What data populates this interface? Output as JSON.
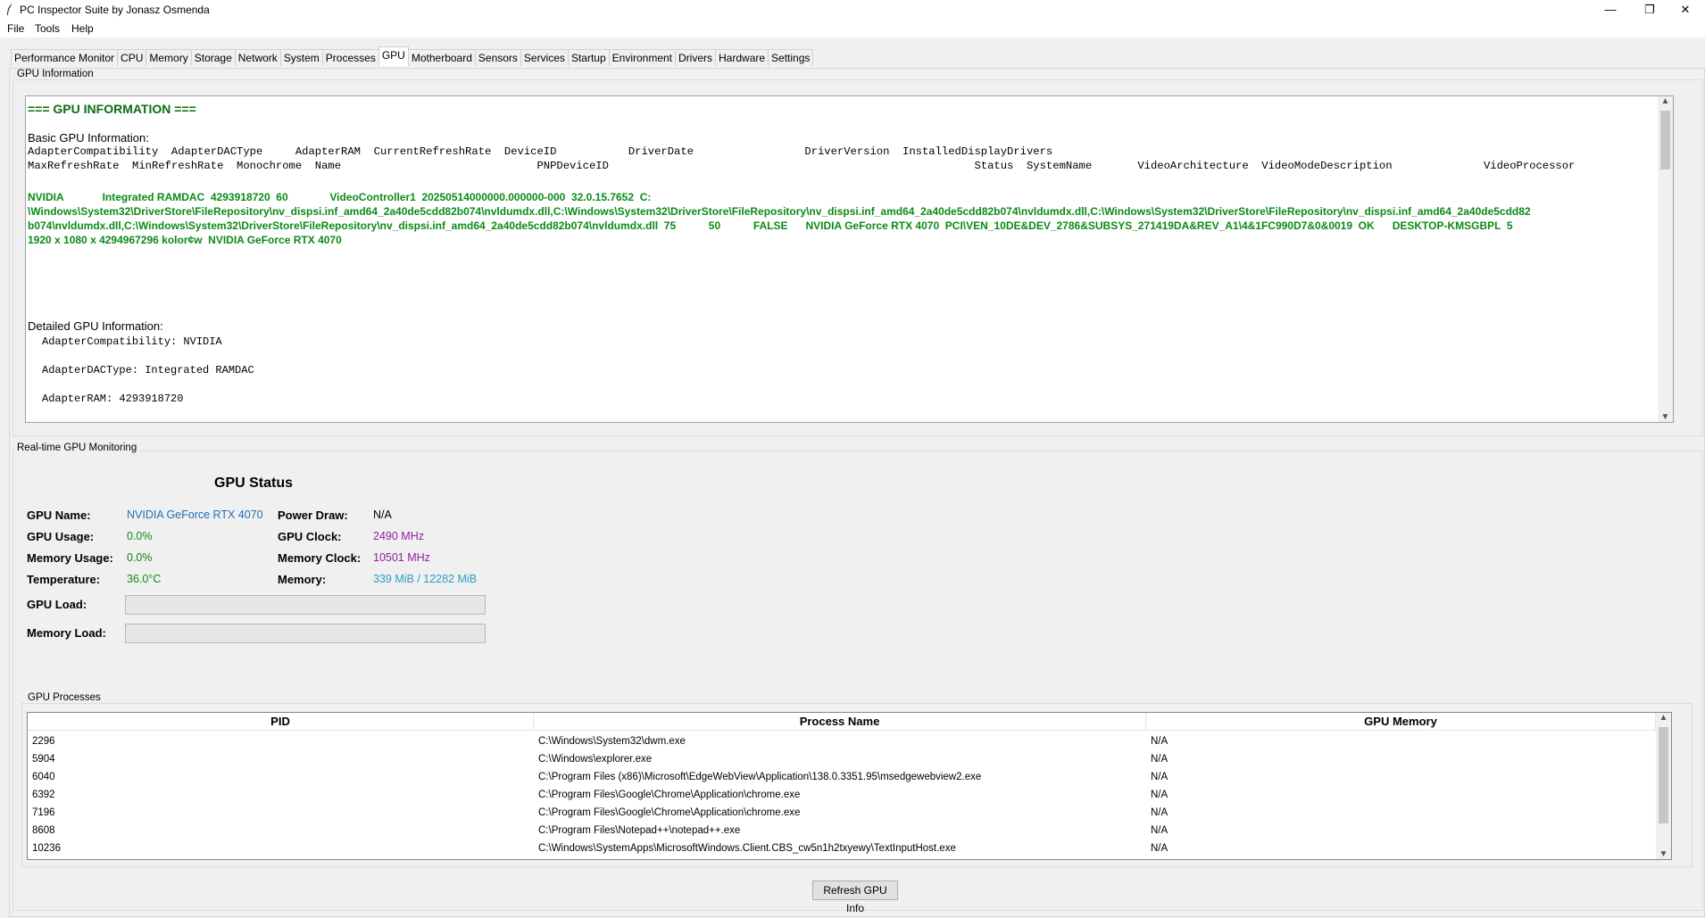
{
  "window": {
    "title": "PC Inspector Suite by Jonasz Osmenda",
    "minimize_glyph": "—",
    "restore_glyph": "❐",
    "close_glyph": "✕"
  },
  "menu": [
    "File",
    "Tools",
    "Help"
  ],
  "tabs": [
    "Performance Monitor",
    "CPU",
    "Memory",
    "Storage",
    "Network",
    "System",
    "Processes",
    "GPU",
    "Motherboard",
    "Sensors",
    "Services",
    "Startup",
    "Environment",
    "Drivers",
    "Hardware",
    "Settings"
  ],
  "active_tab": "GPU",
  "gpu_info": {
    "group_label": "GPU Information",
    "heading": "=== GPU INFORMATION ===",
    "basic_title": "Basic GPU Information:",
    "header_line1": "AdapterCompatibility  AdapterDACType     AdapterRAM  CurrentRefreshRate  DeviceID           DriverDate                 DriverVersion  InstalledDisplayDrivers",
    "header_line2": "MaxRefreshRate  MinRefreshRate  Monochrome  Name                              PNPDeviceID                                                        Status  SystemName       VideoArchitecture  VideoModeDescription              VideoProcessor",
    "data_line1": "NVIDIA             Integrated RAMDAC  4293918720  60              VideoController1  20250514000000.000000-000  32.0.15.7652  C:",
    "data_line2": "\\Windows\\System32\\DriverStore\\FileRepository\\nv_dispsi.inf_amd64_2a40de5cdd82b074\\nvldumdx.dll,C:\\Windows\\System32\\DriverStore\\FileRepository\\nv_dispsi.inf_amd64_2a40de5cdd82b074\\nvldumdx.dll,C:\\Windows\\System32\\DriverStore\\FileRepository\\nv_dispsi.inf_amd64_2a40de5cdd82",
    "data_line3": "b074\\nvldumdx.dll,C:\\Windows\\System32\\DriverStore\\FileRepository\\nv_dispsi.inf_amd64_2a40de5cdd82b074\\nvldumdx.dll  75           50           FALSE      NVIDIA GeForce RTX 4070  PCI\\VEN_10DE&DEV_2786&SUBSYS_271419DA&REV_A1\\4&1FC990D7&0&0019  OK      DESKTOP-KMSGBPL  5",
    "data_line4": "1920 x 1080 x 4294967296 kolor¢w  NVIDIA GeForce RTX 4070",
    "detailed_title": "Detailed GPU Information:",
    "detail_1": "AdapterCompatibility: NVIDIA",
    "detail_2": "AdapterDACType: Integrated RAMDAC",
    "detail_3": "AdapterRAM: 4293918720"
  },
  "monitoring": {
    "group_label": "Real-time GPU Monitoring",
    "status_title": "GPU Status",
    "gpu_name_label": "GPU Name:",
    "gpu_name": "NVIDIA GeForce RTX 4070",
    "gpu_usage_label": "GPU Usage:",
    "gpu_usage": "0.0%",
    "memory_usage_label": "Memory Usage:",
    "memory_usage": "0.0%",
    "temperature_label": "Temperature:",
    "temperature": "36.0°C",
    "power_draw_label": "Power Draw:",
    "power_draw": "N/A",
    "gpu_clock_label": "GPU Clock:",
    "gpu_clock": "2490 MHz",
    "memory_clock_label": "Memory Clock:",
    "memory_clock": "10501 MHz",
    "memory_label": "Memory:",
    "memory": "339 MiB / 12282 MiB",
    "gpu_load_label": "GPU Load:",
    "gpu_load_fraction": 0.0,
    "memory_load_label": "Memory Load:",
    "memory_load_fraction": 0.0,
    "colors": {
      "name": "#1f6fb5",
      "usage": "#0c8a18",
      "clock": "#8e1fa0",
      "memory": "#2a9dc1"
    }
  },
  "processes": {
    "group_label": "GPU Processes",
    "columns": [
      "PID",
      "Process Name",
      "GPU Memory"
    ],
    "rows": [
      [
        "2296",
        "C:\\Windows\\System32\\dwm.exe",
        "N/A"
      ],
      [
        "5904",
        "C:\\Windows\\explorer.exe",
        "N/A"
      ],
      [
        "6040",
        "C:\\Program Files (x86)\\Microsoft\\EdgeWebView\\Application\\138.0.3351.95\\msedgewebview2.exe",
        "N/A"
      ],
      [
        "6392",
        "C:\\Program Files\\Google\\Chrome\\Application\\chrome.exe",
        "N/A"
      ],
      [
        "7196",
        "C:\\Program Files\\Google\\Chrome\\Application\\chrome.exe",
        "N/A"
      ],
      [
        "8608",
        "C:\\Program Files\\Notepad++\\notepad++.exe",
        "N/A"
      ],
      [
        "10236",
        "C:\\Windows\\SystemApps\\MicrosoftWindows.Client.CBS_cw5n1h2txyewy\\TextInputHost.exe",
        "N/A"
      ]
    ]
  },
  "refresh_button": "Refresh GPU Info"
}
